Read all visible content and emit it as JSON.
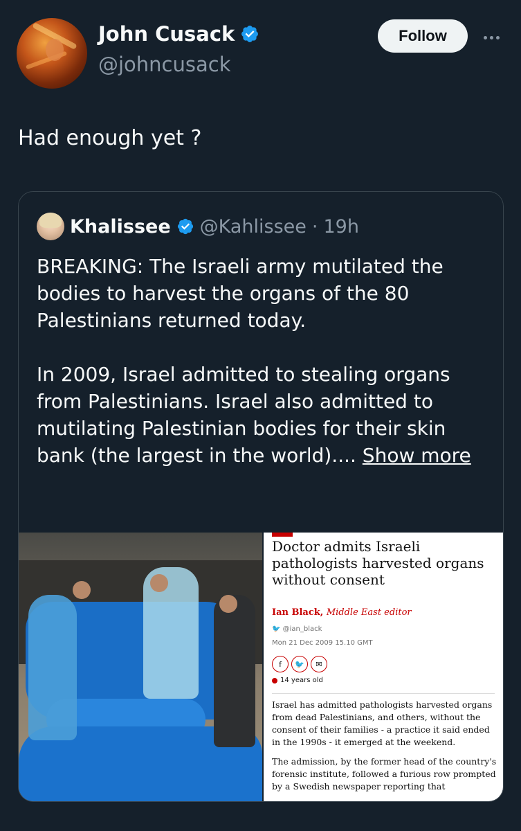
{
  "author": {
    "display_name": "John Cusack",
    "handle": "@johncusack",
    "verified": true,
    "follow_label": "Follow"
  },
  "tweet": {
    "text": "Had enough yet ?"
  },
  "quoted_tweet": {
    "display_name": "Khalissee",
    "handle": "@Kahlissee",
    "separator": "·",
    "time": "19h",
    "verified": true,
    "paragraph1": "BREAKING: The Israeli army mutilated the bodies to harvest the organs of the 80 Palestinians returned today.",
    "paragraph2": "In 2009, Israel admitted to stealing organs from Palestinians. Israel also admitted to mutilating Palestinian bodies for their skin bank (the largest in the world)....",
    "show_more": "Show more"
  },
  "article": {
    "title": "Doctor admits Israeli pathologists harvested organs without consent",
    "author_name": "Ian Black,",
    "author_role": "Middle East editor",
    "author_handle": "@ian_black",
    "date": "Mon 21 Dec 2009 15.10 GMT",
    "age": "14 years old",
    "paragraph1": "Israel has admitted pathologists harvested organs from dead Palestinians, and others, without the consent of their families - a practice it said ended in the 1990s - it emerged at the weekend.",
    "paragraph2": "The admission, by the former head of the country's forensic institute, followed a furious row prompted by a Swedish newspaper reporting that"
  },
  "colors": {
    "background": "#15202b",
    "verified_blue": "#1d9bf0",
    "muted_text": "#8b98a5",
    "border": "#38444d",
    "guardian_red": "#c70000"
  },
  "icons": [
    "verified-badge-icon",
    "more-options-icon",
    "twitter-bird-icon",
    "facebook-icon",
    "email-icon",
    "clock-icon"
  ]
}
